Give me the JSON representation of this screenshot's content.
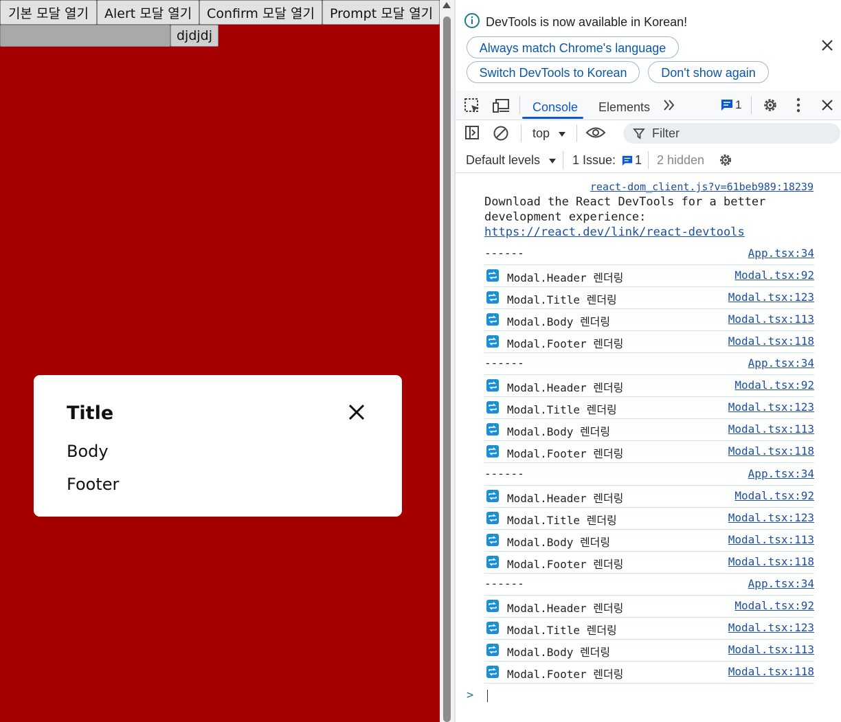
{
  "app": {
    "buttons": [
      "기본 모달 열기",
      "Alert 모달 열기",
      "Confirm 모달 열기",
      "Prompt 모달 열기"
    ],
    "row2_button": "djdjdj",
    "background": "#a40000",
    "modal": {
      "title": "Title",
      "body": "Body",
      "footer": "Footer"
    }
  },
  "devtools": {
    "info_text": "DevTools is now available in Korean!",
    "btn_always": "Always match Chrome's language",
    "btn_switch": "Switch DevTools to Korean",
    "btn_dont_show": "Don't show again",
    "tabs": {
      "console": "Console",
      "elements": "Elements"
    },
    "issues_badge_count": "1",
    "context": "top",
    "filter_placeholder": "Filter",
    "levels": "Default levels",
    "issue_label": "1 Issue:",
    "issue_count": "1",
    "hidden": "2 hidden",
    "console": {
      "react_source": "react-dom_client.js?v=61beb989:18239",
      "react_msg_line1": "Download the React DevTools for a better",
      "react_msg_line2": "development experience:",
      "react_link": "https://react.dev/link/react-devtools",
      "rows": [
        {
          "type": "sep",
          "msg": "------",
          "src": "App.tsx:34"
        },
        {
          "type": "log",
          "msg": "Modal.Header 렌더링",
          "src": "Modal.tsx:92"
        },
        {
          "type": "log",
          "msg": "Modal.Title 렌더링",
          "src": "Modal.tsx:123"
        },
        {
          "type": "log",
          "msg": "Modal.Body 렌더링",
          "src": "Modal.tsx:113"
        },
        {
          "type": "log",
          "msg": "Modal.Footer 렌더링",
          "src": "Modal.tsx:118"
        },
        {
          "type": "sep",
          "msg": "------",
          "src": "App.tsx:34"
        },
        {
          "type": "log",
          "msg": "Modal.Header 렌더링",
          "src": "Modal.tsx:92"
        },
        {
          "type": "log",
          "msg": "Modal.Title 렌더링",
          "src": "Modal.tsx:123"
        },
        {
          "type": "log",
          "msg": "Modal.Body 렌더링",
          "src": "Modal.tsx:113"
        },
        {
          "type": "log",
          "msg": "Modal.Footer 렌더링",
          "src": "Modal.tsx:118"
        },
        {
          "type": "sep",
          "msg": "------",
          "src": "App.tsx:34"
        },
        {
          "type": "log",
          "msg": "Modal.Header 렌더링",
          "src": "Modal.tsx:92"
        },
        {
          "type": "log",
          "msg": "Modal.Title 렌더링",
          "src": "Modal.tsx:123"
        },
        {
          "type": "log",
          "msg": "Modal.Body 렌더링",
          "src": "Modal.tsx:113"
        },
        {
          "type": "log",
          "msg": "Modal.Footer 렌더링",
          "src": "Modal.tsx:118"
        },
        {
          "type": "sep",
          "msg": "------",
          "src": "App.tsx:34"
        },
        {
          "type": "log",
          "msg": "Modal.Header 렌더링",
          "src": "Modal.tsx:92"
        },
        {
          "type": "log",
          "msg": "Modal.Title 렌더링",
          "src": "Modal.tsx:123"
        },
        {
          "type": "log",
          "msg": "Modal.Body 렌더링",
          "src": "Modal.tsx:113"
        },
        {
          "type": "log",
          "msg": "Modal.Footer 렌더링",
          "src": "Modal.tsx:118"
        }
      ]
    },
    "prompt_symbol": ">"
  }
}
